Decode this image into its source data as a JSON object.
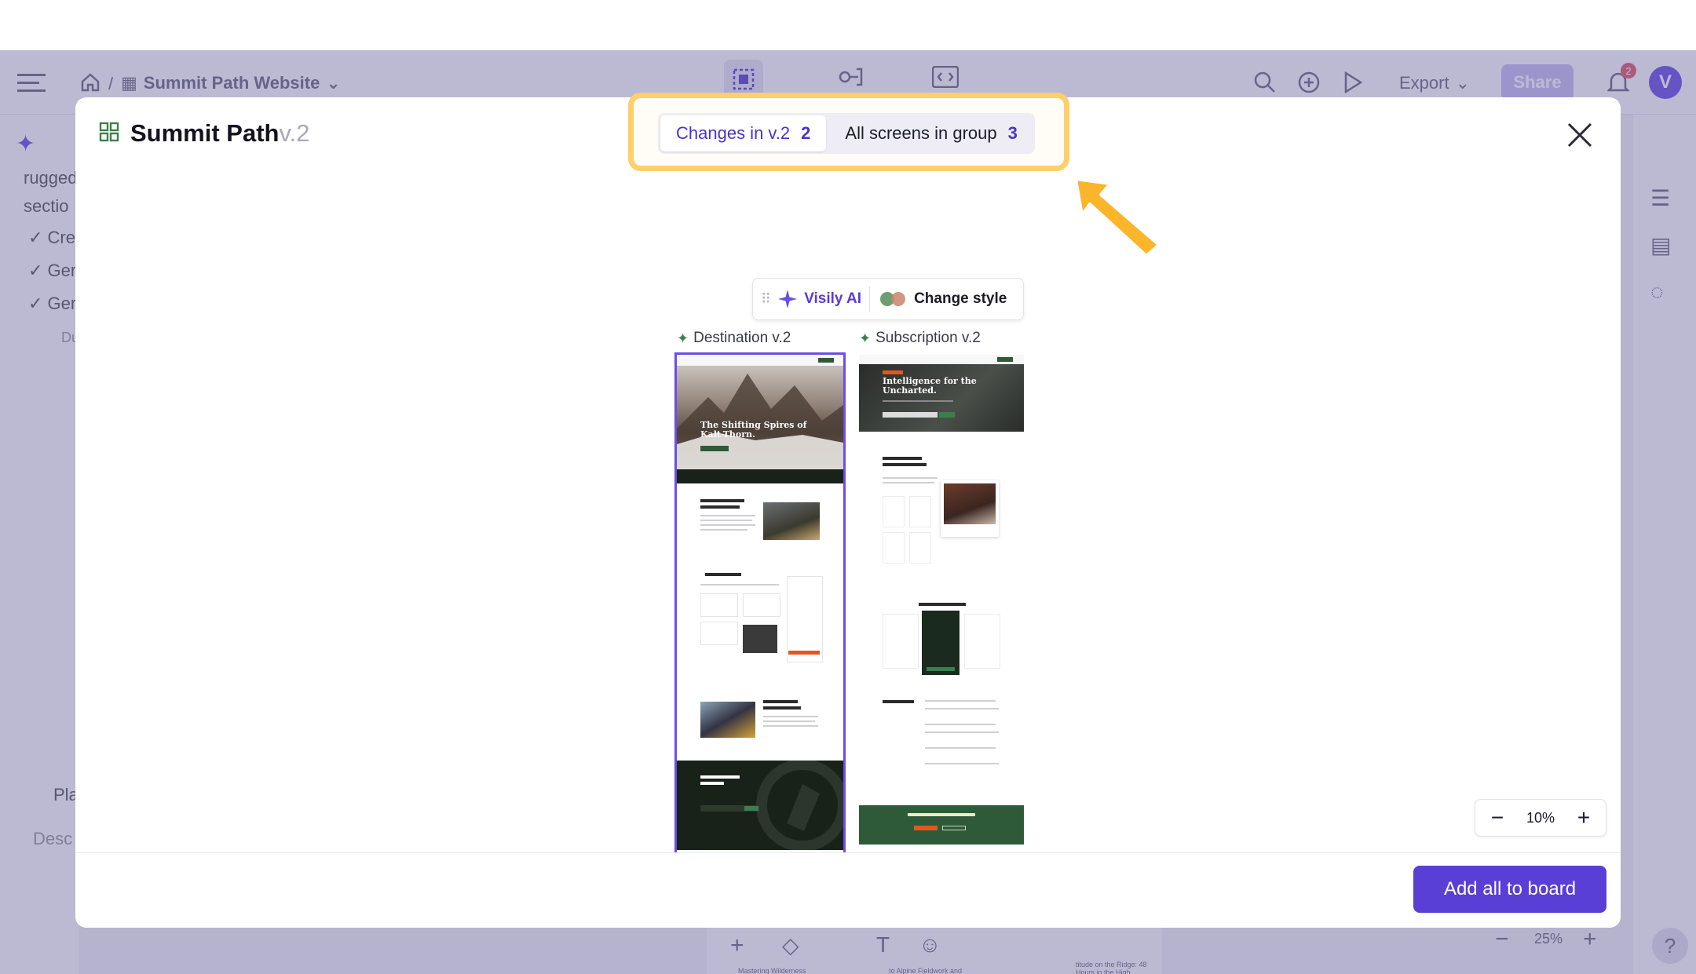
{
  "app": {
    "breadcrumb_project": "Summit Path Website",
    "export_label": "Export",
    "share_label": "Share",
    "notification_count": "2",
    "avatar_initial": "V",
    "left_texts": [
      "rugged",
      "sectio",
      "Cre",
      "Ger",
      "Ger",
      "Du",
      "Pla",
      "Desc"
    ],
    "bottom_zoom": "25%",
    "bottom_captions": [
      "Mastering Wilderness",
      "to Alpine Fieldwork and",
      "titude on the Ridge: 48 Hours in the High"
    ],
    "help_label": "?"
  },
  "modal": {
    "title": "Summit Path",
    "version": "v.2",
    "tabs": [
      {
        "label": "Changes in v.2",
        "count": "2",
        "active": true
      },
      {
        "label": "All screens in group",
        "count": "3",
        "active": false
      }
    ],
    "ai_toolbar": {
      "visily_label": "Visily AI",
      "style_label": "Change style"
    },
    "screens": [
      {
        "label": "Destination v.2",
        "selected": true,
        "hero_title": "The Shifting Spires of Kalt-Thorn.",
        "section_titles": [
          "A Cathedral of Granite and Ice.",
          "Field Intelligence",
          "Tools for the Absolute Edge.",
          "Don't Climb Blind.",
          "Related Expeditions"
        ]
      },
      {
        "label": "Subscription v.2",
        "selected": false,
        "hero_title": "Intelligence for the Uncharted.",
        "section_titles": [
          "Why we wander deeper than the rest.",
          "Elevate Your Expedition",
          "The Scout",
          "The Pathfinder",
          "The Explorer",
          "Frequently Asked Intelligence",
          "Ready for the Next Peak?"
        ]
      }
    ],
    "zoom_value": "10%",
    "add_button_label": "Add all to board"
  },
  "colors": {
    "accent": "#5a3fd6",
    "highlight": "#ffcf6b",
    "arrow": "#fbb52a",
    "forest": "#2f5a39"
  }
}
